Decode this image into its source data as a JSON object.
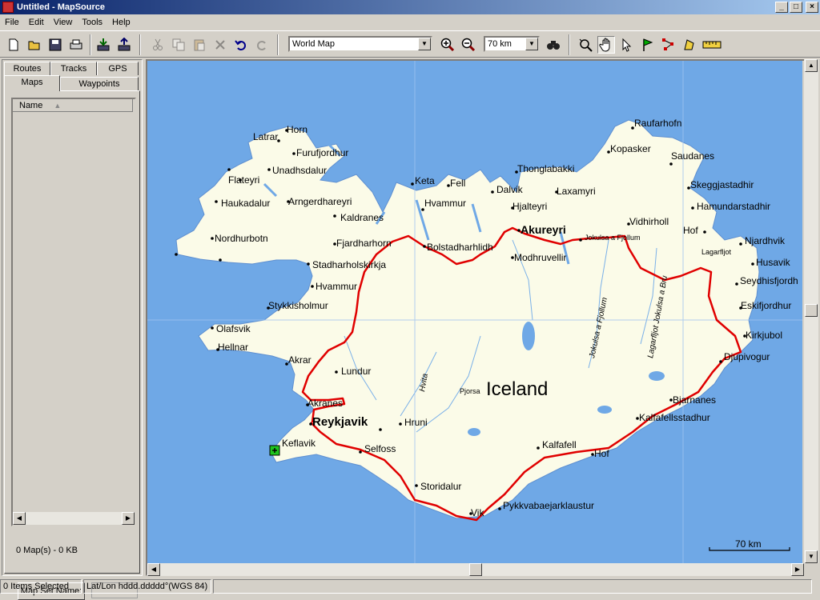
{
  "window": {
    "title": "Untitled - MapSource"
  },
  "menu": [
    "File",
    "Edit",
    "View",
    "Tools",
    "Help"
  ],
  "toolbar": {
    "map_product": "World Map",
    "zoom_level": "70 km",
    "icons": [
      "new-icon",
      "open-icon",
      "save-icon",
      "print-icon",
      "receive-from-device-icon",
      "send-to-device-icon",
      "cut-icon",
      "copy-icon",
      "paste-icon",
      "delete-icon",
      "undo-icon",
      "redo-icon",
      "zoom-in-icon",
      "zoom-out-icon",
      "find-icon",
      "zoom-tool-icon",
      "hand-tool-icon",
      "selection-tool-icon",
      "waypoint-tool-icon",
      "route-tool-icon",
      "track-tool-icon",
      "measure-tool-icon"
    ]
  },
  "left_panel": {
    "tabs_top": [
      "Routes",
      "Tracks",
      "GPS"
    ],
    "tabs_bottom": [
      "Maps",
      "Waypoints"
    ],
    "selected_tab": "Maps",
    "column_header": "Name",
    "maps_count": "0 Map(s) - 0 KB",
    "map_set_button": "Map Set Name:"
  },
  "map": {
    "country_label": "Iceland",
    "scale_label": "70 km",
    "colors": {
      "water": "#6fa8e6",
      "land": "#fbfbe8",
      "route": "#e00000"
    },
    "cities_major": [
      "Reykjavik",
      "Akureyri"
    ],
    "places": [
      "Horn",
      "Latrar",
      "Furufjordhur",
      "Unadhsdalur",
      "Flateyri",
      "Haukadalur",
      "Arngerdhareyri",
      "Kaldranes",
      "Nordhurbotn",
      "Fjardharhorn",
      "Stadharholskirkja",
      "Hvammur",
      "Stykkisholmur",
      "Olafsvik",
      "Hellnar",
      "Akrar",
      "Lundur",
      "Akranes",
      "Keflavik",
      "Selfoss",
      "Hruni",
      "Storidalur",
      "Vik",
      "Pykkvabaejarklaustur",
      "Kalfafell",
      "Hof",
      "Kalfafellsstadhur",
      "Bjarnanes",
      "Djupivogur",
      "Kirkjubol",
      "Eskifjordhur",
      "Seydhisfjordh",
      "Husavik",
      "Njardhvik",
      "Lagarfljot",
      "Hof",
      "Vidhirholl",
      "Hamundarstadhir",
      "Skeggjastadhir",
      "Saudanes",
      "Raufarhofn",
      "Kopasker",
      "Thonglabakki",
      "Laxamyri",
      "Dalvik",
      "Hjalteyri",
      "Keta",
      "Fell",
      "Hvammur",
      "Bolstadharhlidh",
      "Modhruvellir",
      "Jokulsa a Fjollum",
      "Pjorsa",
      "Hvita",
      "Jokulsa a Fjollum",
      "Lagarfljot Jokulsa a Bru"
    ]
  },
  "status": {
    "selection": "0 Items Selected",
    "coords": "Lat/Lon hddd.ddddd°(WGS 84)"
  }
}
